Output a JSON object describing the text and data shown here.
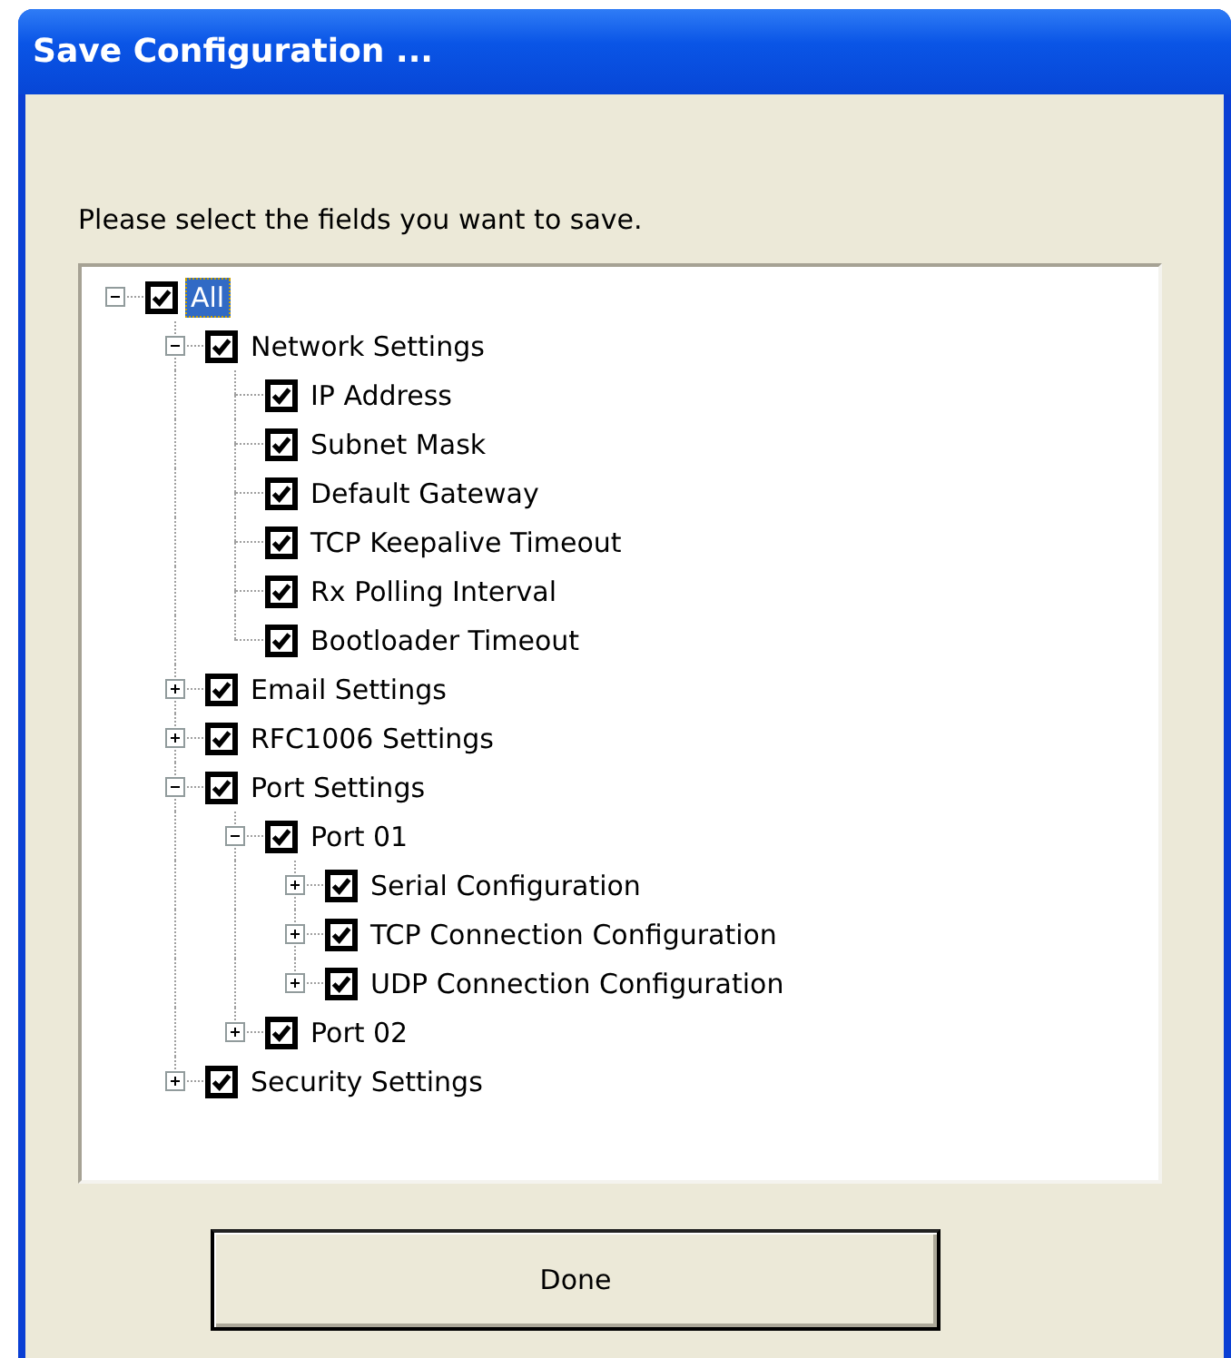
{
  "window": {
    "title": "Save Configuration ..."
  },
  "instruction": "Please select the fields you want to save.",
  "tree": [
    {
      "label": "All",
      "checked": true,
      "selected": true,
      "expanded": true,
      "children": [
        {
          "label": "Network Settings",
          "checked": true,
          "selected": false,
          "expanded": true,
          "children": [
            {
              "label": "IP Address",
              "checked": true,
              "selected": false
            },
            {
              "label": "Subnet Mask",
              "checked": true,
              "selected": false
            },
            {
              "label": "Default Gateway",
              "checked": true,
              "selected": false
            },
            {
              "label": "TCP Keepalive Timeout",
              "checked": true,
              "selected": false
            },
            {
              "label": "Rx Polling Interval",
              "checked": true,
              "selected": false
            },
            {
              "label": "Bootloader Timeout",
              "checked": true,
              "selected": false
            }
          ]
        },
        {
          "label": "Email Settings",
          "checked": true,
          "selected": false,
          "expanded": false
        },
        {
          "label": "RFC1006 Settings",
          "checked": true,
          "selected": false,
          "expanded": false
        },
        {
          "label": "Port Settings",
          "checked": true,
          "selected": false,
          "expanded": true,
          "children": [
            {
              "label": "Port 01",
              "checked": true,
              "selected": false,
              "expanded": true,
              "children": [
                {
                  "label": "Serial Configuration",
                  "checked": true,
                  "selected": false,
                  "expanded": false
                },
                {
                  "label": "TCP Connection Configuration",
                  "checked": true,
                  "selected": false,
                  "expanded": false
                },
                {
                  "label": "UDP Connection Configuration",
                  "checked": true,
                  "selected": false,
                  "expanded": false
                }
              ]
            },
            {
              "label": "Port 02",
              "checked": true,
              "selected": false,
              "expanded": false
            }
          ]
        },
        {
          "label": "Security Settings",
          "checked": true,
          "selected": false,
          "expanded": false
        }
      ]
    }
  ],
  "buttons": [
    "Done"
  ]
}
